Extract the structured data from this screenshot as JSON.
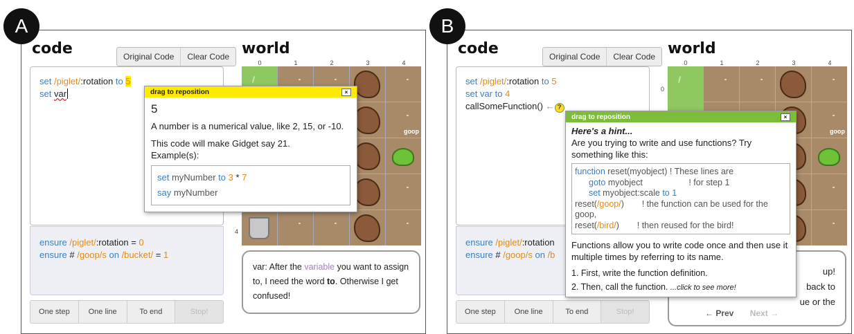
{
  "panels": [
    {
      "badge": "A",
      "code_title": "code",
      "world_title": "world",
      "btn_original": "Original Code",
      "btn_clear": "Clear Code",
      "editor": {
        "line1_kw": "set",
        "line1_path": "/piglet/",
        "line1_rest": ":rotation",
        "line1_to": "to",
        "line1_val": "5",
        "line2_kw": "set",
        "line2_var": "var"
      },
      "ensure": {
        "l1_kw": "ensure",
        "l1_path": "/piglet/",
        "l1_rest": ":rotation = ",
        "l1_val": "0",
        "l2_kw": "ensure",
        "l2_hash": " # ",
        "l2_path": "/goop/s",
        "l2_on": " on ",
        "l2_path2": "/bucket/",
        "l2_eq": " = ",
        "l2_val": "1"
      },
      "controls": [
        "One step",
        "One line",
        "To end",
        "Stop!"
      ],
      "col_numbers": [
        "0",
        "1",
        "2",
        "3",
        "4"
      ],
      "row_number_4": "4",
      "popup": {
        "header": "drag to reposition",
        "close": "×",
        "title": "5",
        "desc": "A number is a numerical value, like 2, 15, or -10.",
        "desc2": "This code will make Gidget say 21.",
        "examples_label": "Example(s):",
        "ex_set": "set",
        "ex_var": " myNumber ",
        "ex_to": "to",
        "ex_n1": "3",
        "ex_op": " * ",
        "ex_n2": "7",
        "ex_say": "say",
        "ex_var2": " myNumber"
      },
      "message": {
        "pre": "var: After the ",
        "var_word": "variable",
        "mid": " you want to assign to, I need the word ",
        "bold": "to",
        "post": ". Otherwise I get confused!"
      },
      "goop_label": "goop"
    },
    {
      "badge": "B",
      "code_title": "code",
      "world_title": "world",
      "btn_original": "Original Code",
      "btn_clear": "Clear Code",
      "editor": {
        "line1_kw": "set",
        "line1_path": "/piglet/",
        "line1_rest": ":rotation",
        "line1_to": "to",
        "line1_val": "5",
        "line2_kw": "set",
        "line2_var": " var ",
        "line2_to": "to",
        "line2_val": "4",
        "line3": "callSomeFunction()",
        "help": "?"
      },
      "ensure": {
        "l1_kw": "ensure",
        "l1_path": "/piglet/",
        "l1_rest": ":rotation",
        "l2_kw": "ensure",
        "l2_hash": " # ",
        "l2_path": "/goop/s",
        "l2_on": " on ",
        "l2_trunc": "/b"
      },
      "controls": [
        "One step",
        "One line",
        "To end",
        "Stop!"
      ],
      "col_numbers": [
        "0",
        "1",
        "2",
        "3",
        "4"
      ],
      "row_number_0": "0",
      "popup": {
        "header": "drag to reposition",
        "close": "×",
        "title": "Here's a hint...",
        "question": "Are you trying to write and use functions? Try something like this:",
        "code": {
          "c1_kw": "function",
          "c1_rest": " reset(myobject)",
          "c1_comment": " ! These lines are",
          "c2_kw": "goto",
          "c2_rest": " myobject",
          "c2_comment": "! for step 1",
          "c3_kw": "set",
          "c3_rest": " myobject:scale ",
          "c3_to": "to",
          "c3_val": " 1",
          "c4_pre": "reset(",
          "c4_path": "/goop/",
          "c4_post": ")",
          "c4_comment": "! the function can be used for the goop,",
          "c5_pre": "reset(",
          "c5_path": "/bird/",
          "c5_post": ")",
          "c5_comment": "! then reused for the bird!"
        },
        "explain": "Functions allow you to write code once and then use it multiple times by referring to its name.",
        "step1": "1. First, write the function definition.",
        "step2": "2. Then, call the function. ",
        "more": "...click to see more!"
      },
      "message": {
        "l1": "up!",
        "l2": "back to",
        "l3": "ue or the"
      },
      "nav_prev": "← Prev",
      "nav_next": "Next →",
      "goop_label": "goop"
    }
  ],
  "colors": {
    "popup_a_header": "#ffea00",
    "popup_b_header": "#7cbd3a",
    "keyword": "#3a7ec4",
    "accent": "#e08b1a",
    "variable": "#a67fc9"
  }
}
